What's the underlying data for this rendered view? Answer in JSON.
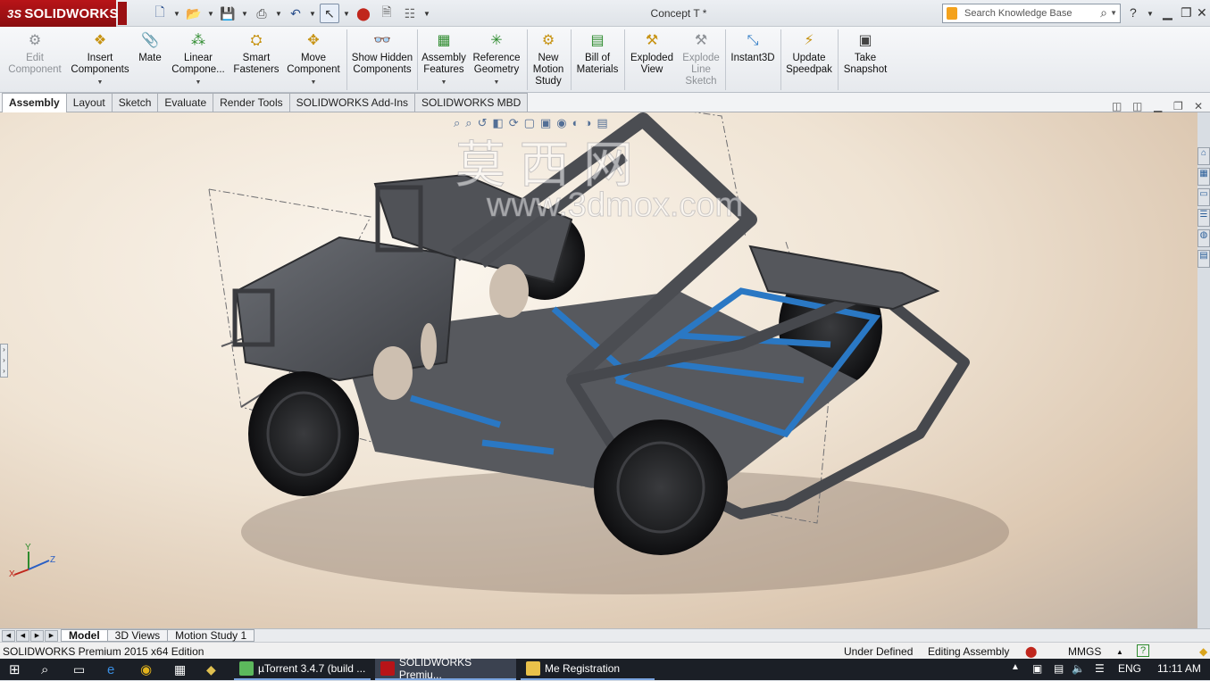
{
  "app": {
    "logo_text": "SOLIDWORKS",
    "doc_title": "Concept T *"
  },
  "search": {
    "placeholder": "Search Knowledge Base"
  },
  "ribbon": {
    "edit_component": "Edit Component",
    "insert_components": "Insert Components",
    "mate": "Mate",
    "linear_component": "Linear Compone...",
    "smart_fasteners": "Smart Fasteners",
    "move_component": "Move Component",
    "show_hidden": "Show Hidden Components",
    "assembly_features": "Assembly Features",
    "reference_geometry": "Reference Geometry",
    "new_motion_study": "New Motion Study",
    "bill_of_materials": "Bill of Materials",
    "exploded_view": "Exploded View",
    "explode_line_sketch": "Explode Line Sketch",
    "instant3d": "Instant3D",
    "update_speedpak": "Update Speedpak",
    "take_snapshot": "Take Snapshot"
  },
  "tabs": [
    "Assembly",
    "Layout",
    "Sketch",
    "Evaluate",
    "Render Tools",
    "SOLIDWORKS Add-Ins",
    "SOLIDWORKS MBD"
  ],
  "watermark": {
    "cn": "莫 西 网",
    "url": "www.3dmox.com"
  },
  "triad": {
    "x": "X",
    "y": "Y",
    "z": "Z"
  },
  "model_tabs": [
    "Model",
    "3D Views",
    "Motion Study 1"
  ],
  "status": {
    "edition": "SOLIDWORKS Premium 2015 x64 Edition",
    "defined": "Under Defined",
    "mode": "Editing Assembly",
    "units": "MMGS",
    "help": "?"
  },
  "taskbar": {
    "apps": [
      "µTorrent 3.4.7  (build ...",
      "SOLIDWORKS Premiu...",
      "Me Registration"
    ],
    "lang": "ENG",
    "time": "11:11 AM"
  },
  "colors": {
    "brand_red": "#b81418",
    "frame_dark": "#4b4d52",
    "frame_blue": "#2a78c4"
  }
}
